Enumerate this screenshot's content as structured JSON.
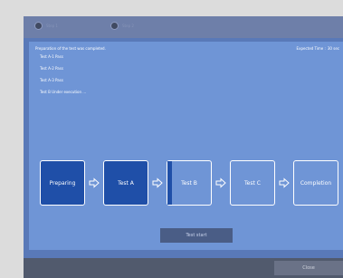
{
  "header": {
    "steps": [
      {
        "label": "Step 1"
      },
      {
        "label": "Step 2"
      }
    ]
  },
  "status": {
    "title": "Preparation of the test was completed.",
    "expected_label": "Expected Time :",
    "expected_value": "30 sec"
  },
  "results": [
    "Test A-1 Pass",
    "Test A-2 Pass",
    "Test A-3 Pass",
    "Test B Under execution ..."
  ],
  "flow": {
    "stages": [
      {
        "label": "Preparing",
        "state": "done"
      },
      {
        "label": "Test A",
        "state": "done"
      },
      {
        "label": "Test B",
        "state": "current"
      },
      {
        "label": "Test C",
        "state": "pending"
      },
      {
        "label": "Completion",
        "state": "pending"
      }
    ]
  },
  "buttons": {
    "start": "Test start",
    "close": "Close"
  },
  "colors": {
    "panel_outer": "#5979b8",
    "panel_inner": "#6f95d6",
    "stage_done": "#1f4fa8",
    "footer": "#515a6d"
  },
  "icons": {
    "stage_arrow": "arrow-right-icon",
    "step_dot": "step-dot-icon"
  }
}
